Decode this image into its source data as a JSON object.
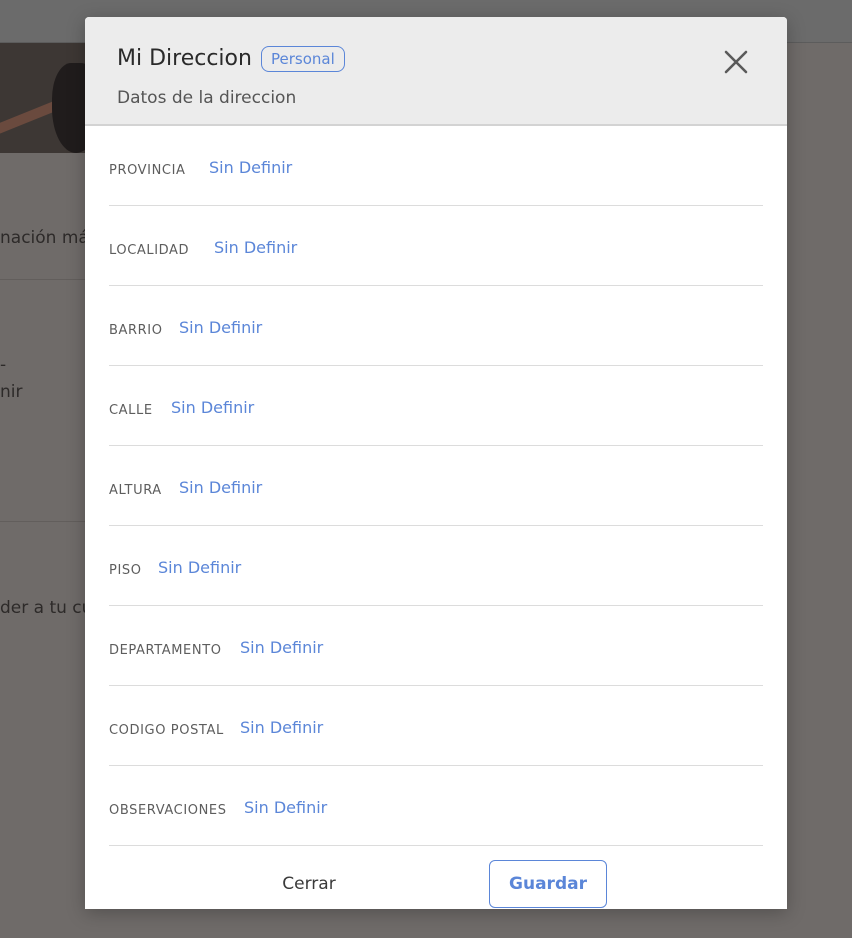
{
  "background": {
    "text_line_1": "nación más",
    "text_line_2": "-",
    "text_line_3": "nir",
    "text_line_4": "der a tu cu"
  },
  "modal": {
    "title": "Mi Direccion",
    "badge": "Personal",
    "subtitle": "Datos de la direccion",
    "fields": [
      {
        "label": "PROVINCIA",
        "value": "Sin Definir"
      },
      {
        "label": "LOCALIDAD",
        "value": "Sin Definir"
      },
      {
        "label": "BARRIO",
        "value": "Sin Definir"
      },
      {
        "label": "CALLE",
        "value": "Sin Definir"
      },
      {
        "label": "ALTURA",
        "value": "Sin Definir"
      },
      {
        "label": "PISO",
        "value": "Sin Definir"
      },
      {
        "label": "DEPARTAMENTO",
        "value": "Sin Definir"
      },
      {
        "label": "CODIGO POSTAL",
        "value": "Sin Definir"
      },
      {
        "label": "OBSERVACIONES",
        "value": "Sin Definir"
      }
    ],
    "close_label": "Cerrar",
    "save_label": "Guardar"
  },
  "colors": {
    "accent": "#5b86d8",
    "header_bg": "#ececec",
    "overlay": "#6f6b69"
  }
}
